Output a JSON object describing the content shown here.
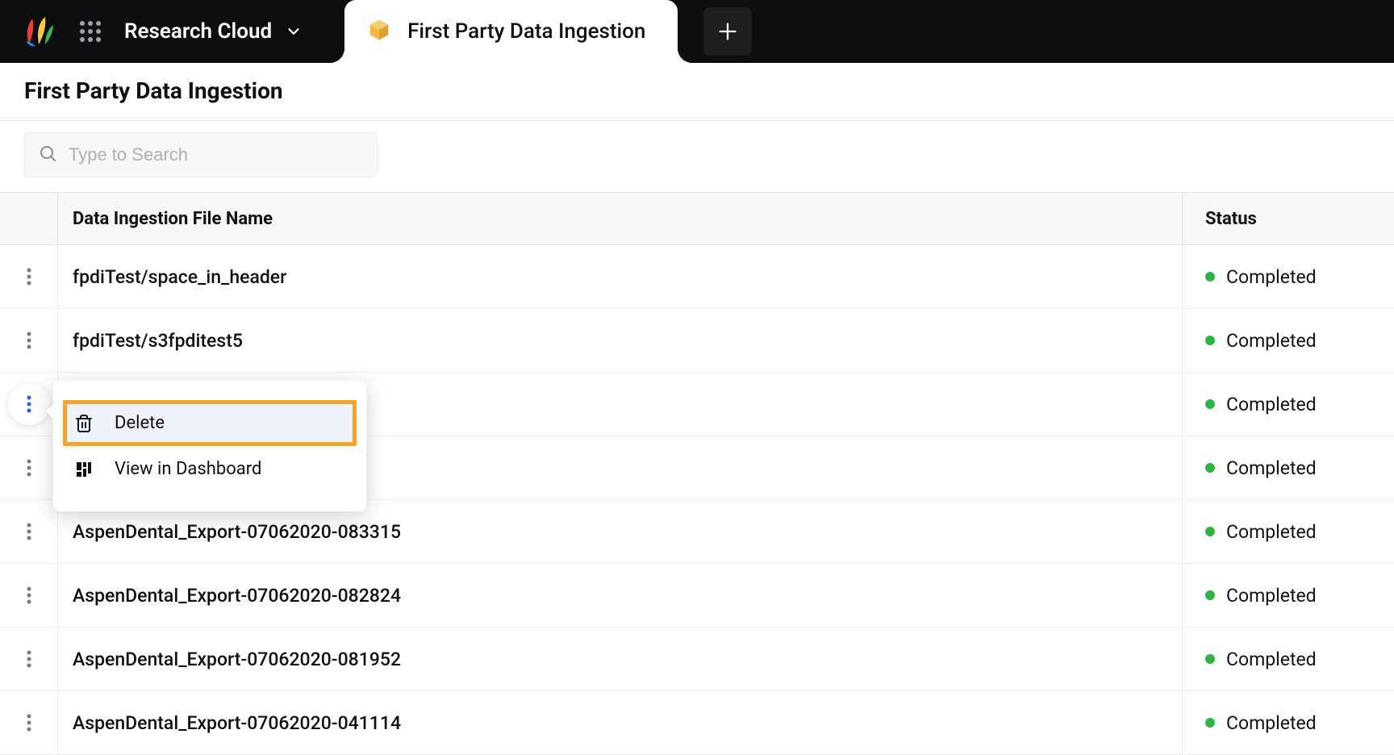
{
  "topbar": {
    "workspace_label": "Research Cloud",
    "active_tab_label": "First Party Data Ingestion"
  },
  "page": {
    "title": "First Party Data Ingestion",
    "search_placeholder": "Type to Search"
  },
  "table": {
    "columns": {
      "name": "Data Ingestion File Name",
      "status": "Status"
    },
    "rows": [
      {
        "name": "fpdiTest/space_in_header",
        "status": "Completed"
      },
      {
        "name": "fpdiTest/s3fpditest5",
        "status": "Completed"
      },
      {
        "name": "",
        "status": "Completed"
      },
      {
        "name": "",
        "status": "Completed"
      },
      {
        "name": "AspenDental_Export-07062020-083315",
        "status": "Completed"
      },
      {
        "name": "AspenDental_Export-07062020-082824",
        "status": "Completed"
      },
      {
        "name": "AspenDental_Export-07062020-081952",
        "status": "Completed"
      },
      {
        "name": "AspenDental_Export-07062020-041114",
        "status": "Completed"
      }
    ]
  },
  "context_menu": {
    "delete_label": "Delete",
    "view_label": "View in Dashboard"
  }
}
